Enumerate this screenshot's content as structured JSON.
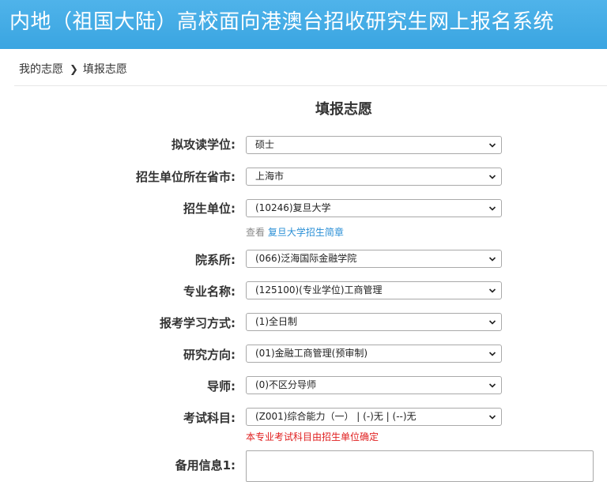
{
  "header": {
    "title": "内地（祖国大陆）高校面向港澳台招收研究生网上报名系统"
  },
  "breadcrumb": {
    "parent": "我的志愿",
    "current": "填报志愿"
  },
  "form": {
    "title": "填报志愿",
    "fields": {
      "degree": {
        "label": "拟攻读学位:",
        "value": "硕士"
      },
      "province": {
        "label": "招生单位所在省市:",
        "value": "上海市"
      },
      "institution": {
        "label": "招生单位:",
        "value": "(10246)复旦大学"
      },
      "department": {
        "label": "院系所:",
        "value": "(066)泛海国际金融学院"
      },
      "major": {
        "label": "专业名称:",
        "value": "(125100)(专业学位)工商管理"
      },
      "study_mode": {
        "label": "报考学习方式:",
        "value": "(1)全日制"
      },
      "research_direction": {
        "label": "研究方向:",
        "value": "(01)金融工商管理(预审制)"
      },
      "supervisor": {
        "label": "导师:",
        "value": "(0)不区分导师"
      },
      "exam_subjects": {
        "label": "考试科目:",
        "value": "(Z001)综合能力（一） | (-)无 | (--)无"
      },
      "backup_info_1": {
        "label": "备用信息1:",
        "value": ""
      }
    },
    "institution_hint": {
      "prefix": "查看",
      "link": "复旦大学招生简章"
    },
    "exam_note": "本专业考试科目由招生单位确定"
  }
}
